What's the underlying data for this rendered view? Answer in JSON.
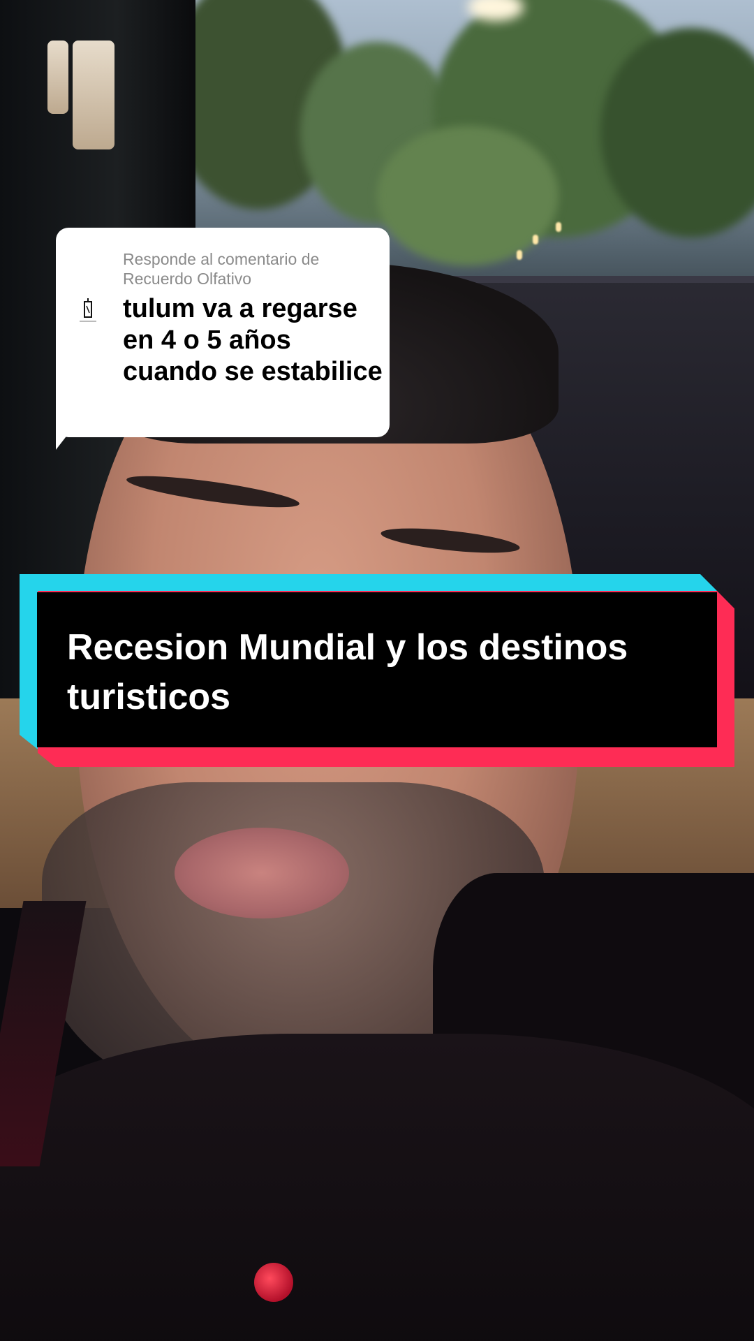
{
  "reply_sticker": {
    "meta": "Responde al comentario de Recuerdo Olfativo",
    "comment": "tulum va a regarse en 4 o 5 años cuando se estabilice",
    "avatar_icon": "recuerdo-olfativo-logo"
  },
  "title_banner": {
    "text": "Recesion Mundial y los destinos turisticos",
    "colors": {
      "cyan": "#25d4eb",
      "red": "#fe2c55",
      "fill": "#000000"
    }
  }
}
